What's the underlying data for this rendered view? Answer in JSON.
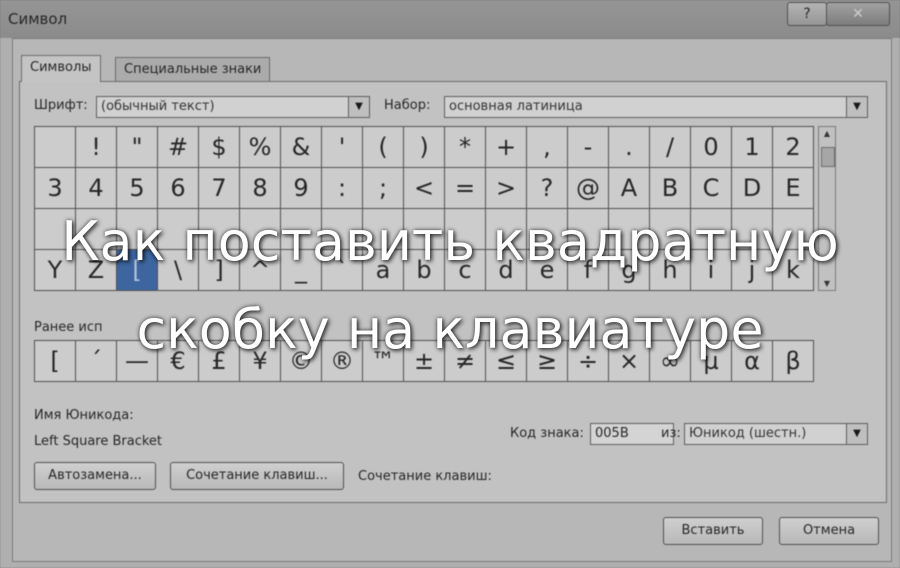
{
  "window": {
    "title": "Символ",
    "help_label": "?",
    "close_label": "✕"
  },
  "tabs": [
    {
      "label": "Символы",
      "active": true
    },
    {
      "label": "Специальные знаки",
      "active": false
    }
  ],
  "font": {
    "label": "Шрифт:",
    "value": "(обычный текст)"
  },
  "subset": {
    "label": "Набор:",
    "value": "основная латиница"
  },
  "grid": {
    "rows": [
      [
        "",
        "!",
        "\"",
        "#",
        "$",
        "%",
        "&",
        "'",
        "(",
        ")",
        "*",
        "+",
        ",",
        "-",
        ".",
        "/",
        "0",
        "1",
        "2"
      ],
      [
        "3",
        "4",
        "5",
        "6",
        "7",
        "8",
        "9",
        ":",
        ";",
        "<",
        "=",
        ">",
        "?",
        "@",
        "A",
        "B",
        "C",
        "D",
        "E"
      ],
      [
        "",
        "",
        "",
        "",
        "",
        "",
        "",
        "",
        "",
        "",
        "",
        "",
        "",
        "",
        "",
        "",
        "",
        "",
        ""
      ],
      [
        "Y",
        "Z",
        "[",
        "\\",
        "]",
        "^",
        "_",
        "`",
        "a",
        "b",
        "c",
        "d",
        "e",
        "f",
        "g",
        "h",
        "i",
        "j",
        "k"
      ]
    ],
    "selected_row": 3,
    "selected_col": 2
  },
  "recent": {
    "label": "Ранее исп",
    "symbols": [
      "[",
      "´",
      "—",
      "€",
      "£",
      "¥",
      "©",
      "®",
      "™",
      "±",
      "≠",
      "≤",
      "≥",
      "÷",
      "×",
      "∞",
      "µ",
      "α",
      "β"
    ]
  },
  "unicode_name": {
    "label": "Имя Юникода:",
    "value": "Left Square Bracket"
  },
  "char_code": {
    "label": "Код знака:",
    "value": "005B"
  },
  "from": {
    "label": "из:",
    "value": "Юникод (шестн.)"
  },
  "buttons": {
    "autocorrect": "Автозамена...",
    "shortcut_key": "Сочетание клавиш...",
    "shortcut_label": "Сочетание клавиш:",
    "insert": "Вставить",
    "cancel": "Отмена"
  },
  "overlay": {
    "line1": "Как поставить квадратную",
    "line2": "скобку на клавиатуре"
  }
}
